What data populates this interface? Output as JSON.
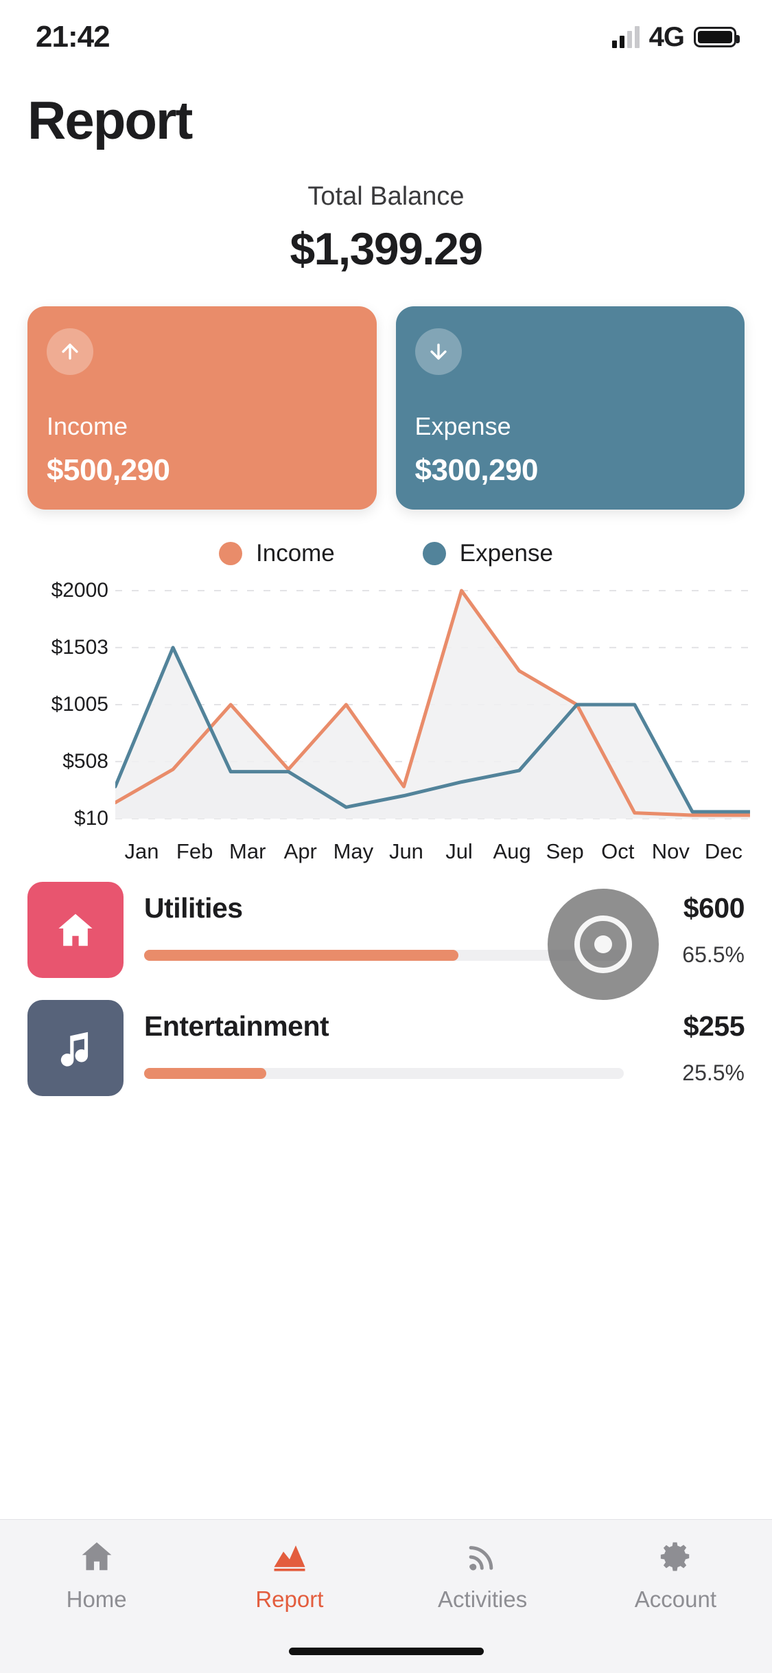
{
  "status_bar": {
    "time": "21:42",
    "network": "4G",
    "signal_icon": "signal-bars-icon",
    "battery_icon": "battery-full-icon"
  },
  "header": {
    "title": "Report"
  },
  "balance": {
    "label": "Total Balance",
    "value": "$1,399.29"
  },
  "summary_cards": [
    {
      "key": "income",
      "label": "Income",
      "value": "$500,290",
      "color": "#E98C6A",
      "icon": "arrow-up-icon"
    },
    {
      "key": "expense",
      "label": "Expense",
      "value": "$300,290",
      "color": "#52839A",
      "icon": "arrow-down-icon"
    }
  ],
  "legend": [
    {
      "label": "Income",
      "color": "#E98C6A"
    },
    {
      "label": "Expense",
      "color": "#52839A"
    }
  ],
  "chart_data": {
    "type": "line",
    "title": "",
    "xlabel": "",
    "ylabel": "",
    "grid": true,
    "legend_position": "top",
    "ylim": [
      10,
      2000
    ],
    "ytick_labels": [
      "$2000",
      "$1503",
      "$1005",
      "$508",
      "$10"
    ],
    "ytick_values": [
      2000,
      1503,
      1005,
      508,
      10
    ],
    "categories": [
      "Jan",
      "Feb",
      "Mar",
      "Apr",
      "May",
      "Jun",
      "Jul",
      "Aug",
      "Sep",
      "Oct",
      "Nov",
      "Dec"
    ],
    "series": [
      {
        "name": "Income",
        "color": "#E98C6A",
        "values": [
          150,
          440,
          1005,
          440,
          1005,
          290,
          2000,
          1300,
          1005,
          60,
          40,
          40
        ]
      },
      {
        "name": "Expense",
        "color": "#52839A",
        "values": [
          290,
          1503,
          420,
          420,
          110,
          210,
          330,
          430,
          1005,
          1005,
          70,
          70
        ]
      }
    ]
  },
  "categories": [
    {
      "name": "Utilities",
      "amount": "$600",
      "percent_label": "65.5%",
      "percent": 65.5,
      "icon": "home-icon",
      "icon_color": "#E8556F"
    },
    {
      "name": "Entertainment",
      "amount": "$255",
      "percent_label": "25.5%",
      "percent": 25.5,
      "icon": "music-note-icon",
      "icon_color": "#57637A"
    }
  ],
  "floating_button": {
    "icon": "record-target-icon"
  },
  "tabbar": [
    {
      "label": "Home",
      "icon": "home-icon",
      "active": false
    },
    {
      "label": "Report",
      "icon": "chart-icon",
      "active": true
    },
    {
      "label": "Activities",
      "icon": "rss-icon",
      "active": false
    },
    {
      "label": "Account",
      "icon": "gear-icon",
      "active": false
    }
  ]
}
